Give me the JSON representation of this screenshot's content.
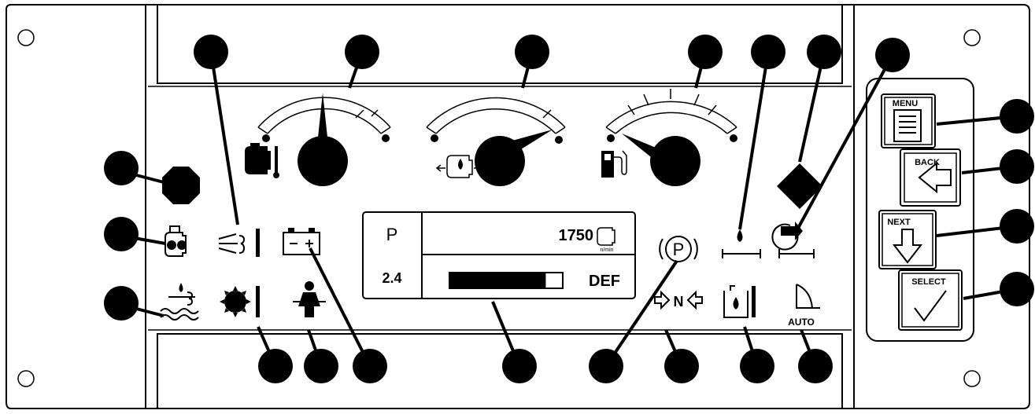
{
  "display": {
    "gear": "P",
    "engine_speed": "1750",
    "speed_unit": "n/min",
    "value": "2.4",
    "def_label": "DEF",
    "def_level": 0.85
  },
  "buttons": {
    "menu": "MENU",
    "back": "BACK",
    "next": "NEXT",
    "select": "SELECT"
  },
  "indicators": {
    "park_brake": "P",
    "neutral": "N",
    "auto": "AUTO"
  }
}
